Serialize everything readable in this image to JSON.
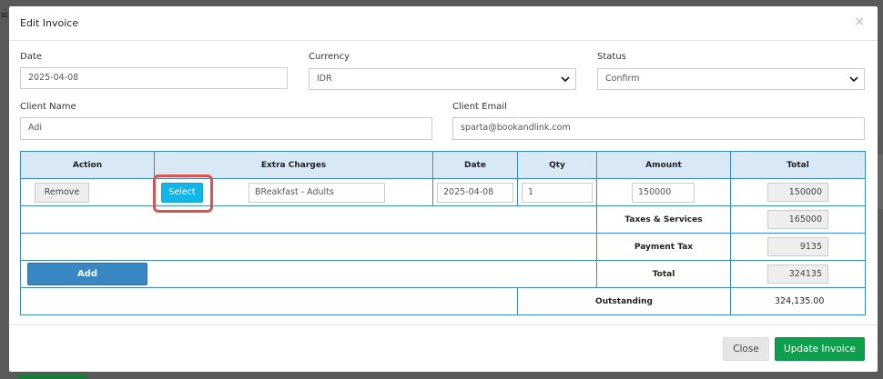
{
  "modal": {
    "title": "Edit Invoice",
    "close_glyph": "×"
  },
  "form": {
    "date": {
      "label": "Date",
      "value": "2025-04-08"
    },
    "currency": {
      "label": "Currency",
      "value": "IDR"
    },
    "status": {
      "label": "Status",
      "value": "Confirm"
    },
    "client_name": {
      "label": "Client Name",
      "value": "Adi"
    },
    "client_email": {
      "label": "Client Email",
      "value": "sparta@bookandlink.com"
    }
  },
  "table": {
    "headers": [
      "Action",
      "Extra Charges",
      "Date",
      "Qty",
      "Amount",
      "Total"
    ],
    "row": {
      "remove_label": "Remove",
      "select_label": "Select",
      "extra_charge": "BReakfast - Adults",
      "date": "2025-04-08",
      "qty": "1",
      "amount": "150000",
      "total": "150000"
    },
    "taxes": {
      "label": "Taxes & Services",
      "value": "165000"
    },
    "payment_tax": {
      "label": "Payment Tax",
      "value": "9135"
    },
    "total": {
      "label": "Total",
      "value": "324135"
    },
    "add_label": "Add",
    "outstanding": {
      "label": "Outstanding",
      "value": "324,135.00"
    }
  },
  "footer": {
    "close_label": "Close",
    "update_label": "Update Invoice"
  },
  "colors": {
    "select_button": "#13b6e8",
    "add_button": "#3a88c3",
    "update_button": "#0d9f4c",
    "table_border": "#3b89c4",
    "table_header": "#d9e8f5",
    "highlight": "#d9534f"
  },
  "icons": [
    "menu-icon",
    "close-icon",
    "chevron-down-icon"
  ]
}
